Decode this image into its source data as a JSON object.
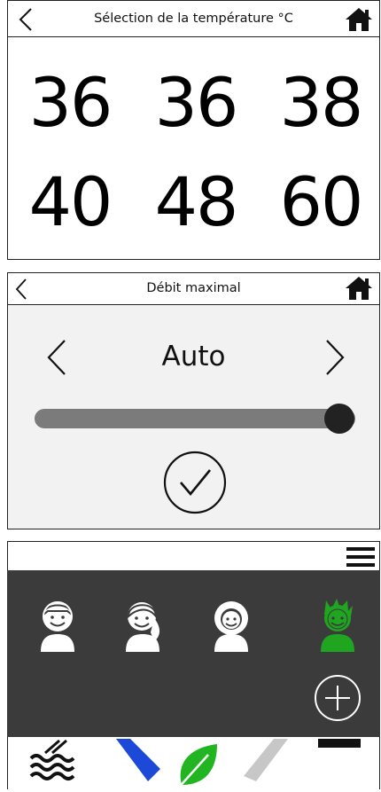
{
  "temperature_panel": {
    "title": "Sélection de la température °C",
    "values": [
      "36",
      "36",
      "38",
      "40",
      "48",
      "60"
    ]
  },
  "flow_panel": {
    "title": "Débit maximal",
    "mode": "Auto",
    "slider_level_fraction": 0.95
  },
  "profiles_panel": {
    "avatars": [
      {
        "name": "boy",
        "color": "#ffffff"
      },
      {
        "name": "girl",
        "color": "#ffffff"
      },
      {
        "name": "woman-curly",
        "color": "#ffffff"
      },
      {
        "name": "child-spiky",
        "color": "#1fa51f",
        "selected": true
      }
    ],
    "bottom_icons": [
      "waves-icon",
      "blue-stripe-icon",
      "leaf-icon",
      "grey-stripe-icon",
      "black-bar-icon"
    ]
  },
  "colors": {
    "overlay": "#3b3b3b",
    "selected_avatar": "#1fa51f",
    "leaf": "#22b522",
    "blue": "#1d49d8"
  }
}
